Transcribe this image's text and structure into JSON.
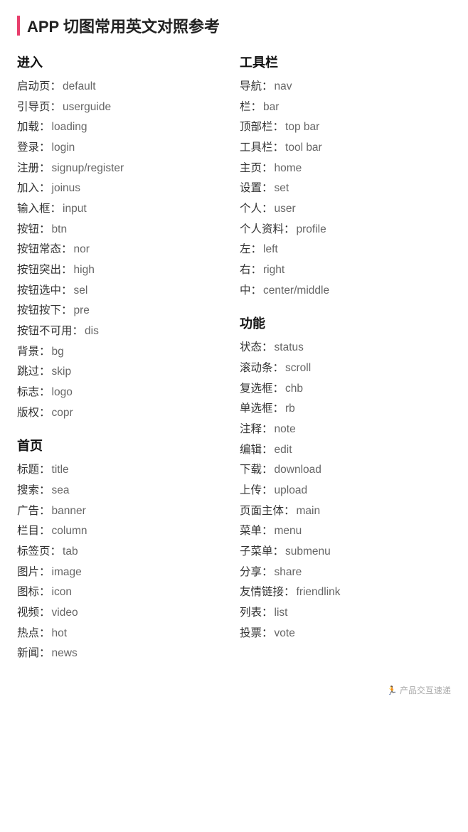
{
  "title": "APP 切图常用英文对照参考",
  "accent_color": "#e83e6c",
  "left": {
    "sections": [
      {
        "title": "进入",
        "items": [
          {
            "zh": "启动页：",
            "en": "default"
          },
          {
            "zh": "引导页：",
            "en": "userguide"
          },
          {
            "zh": "加载：",
            "en": "loading"
          },
          {
            "zh": "登录：",
            "en": "login"
          },
          {
            "zh": "注册：",
            "en": "signup/register"
          },
          {
            "zh": "加入：",
            "en": "joinus"
          },
          {
            "zh": "输入框：",
            "en": "input"
          },
          {
            "zh": "按钮：",
            "en": "btn"
          },
          {
            "zh": "按钮常态：",
            "en": "nor"
          },
          {
            "zh": "按钮突出：",
            "en": "high"
          },
          {
            "zh": "按钮选中：",
            "en": "sel"
          },
          {
            "zh": "按钮按下：",
            "en": "pre"
          },
          {
            "zh": "按钮不可用：",
            "en": "dis"
          },
          {
            "zh": "背景：",
            "en": "bg"
          },
          {
            "zh": "跳过：",
            "en": "skip"
          },
          {
            "zh": "标志：",
            "en": "logo"
          },
          {
            "zh": "版权：",
            "en": "copr"
          }
        ]
      },
      {
        "title": "首页",
        "items": [
          {
            "zh": "标题：",
            "en": "title"
          },
          {
            "zh": "搜索：",
            "en": "sea"
          },
          {
            "zh": "广告：",
            "en": "banner"
          },
          {
            "zh": "栏目：",
            "en": "column"
          },
          {
            "zh": "标签页：",
            "en": "tab"
          },
          {
            "zh": "图片：",
            "en": "image"
          },
          {
            "zh": "图标：",
            "en": "icon"
          },
          {
            "zh": "视频：",
            "en": "video"
          },
          {
            "zh": "热点：",
            "en": "hot"
          },
          {
            "zh": "新闻：",
            "en": "news"
          }
        ]
      }
    ]
  },
  "right": {
    "sections": [
      {
        "title": "工具栏",
        "items": [
          {
            "zh": "导航：",
            "en": "nav"
          },
          {
            "zh": "栏：",
            "en": "bar"
          },
          {
            "zh": "顶部栏：",
            "en": "top bar"
          },
          {
            "zh": "工具栏：",
            "en": "tool bar"
          },
          {
            "zh": "主页：",
            "en": "home"
          },
          {
            "zh": "设置：",
            "en": "set"
          },
          {
            "zh": "个人：",
            "en": "user"
          },
          {
            "zh": "个人资料：",
            "en": "profile"
          },
          {
            "zh": "左：",
            "en": "left"
          },
          {
            "zh": "右：",
            "en": "right"
          },
          {
            "zh": "中：",
            "en": "center/middle"
          }
        ]
      },
      {
        "title": "功能",
        "items": [
          {
            "zh": "状态：",
            "en": "status"
          },
          {
            "zh": "滚动条：",
            "en": "scroll"
          },
          {
            "zh": "复选框：",
            "en": "chb"
          },
          {
            "zh": "单选框：",
            "en": "rb"
          },
          {
            "zh": "注释：",
            "en": "note"
          },
          {
            "zh": "编辑：",
            "en": "edit"
          },
          {
            "zh": "下载：",
            "en": "download"
          },
          {
            "zh": "上传：",
            "en": "upload"
          },
          {
            "zh": "页面主体：",
            "en": "main"
          },
          {
            "zh": "菜单：",
            "en": "menu"
          },
          {
            "zh": "子菜单：",
            "en": "submenu"
          },
          {
            "zh": "分享：",
            "en": "share"
          },
          {
            "zh": "友情链接：",
            "en": "friendlink"
          },
          {
            "zh": "列表：",
            "en": "list"
          },
          {
            "zh": "投票：",
            "en": "vote"
          }
        ]
      }
    ]
  },
  "watermark": "产品交互速递"
}
